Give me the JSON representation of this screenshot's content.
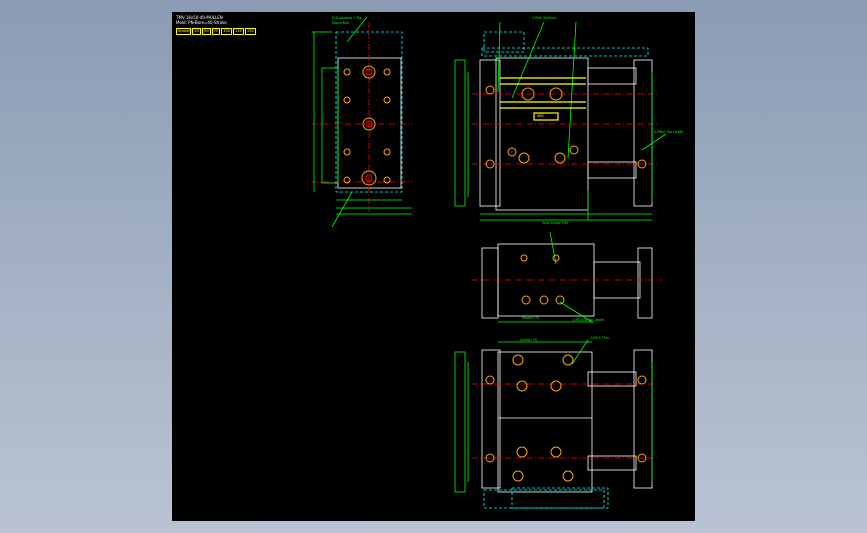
{
  "title_block": {
    "line1": "TMV-16x50-40-MULLEN",
    "line2": "Mold: PN-Bore=40-Stroke"
  },
  "strokes": [
    "Stroke",
    "25",
    "50",
    "75",
    "100",
    "125",
    "150"
  ],
  "labels": {
    "cap_tap": "M-6 Adapted 1 Tap",
    "depth_note": "Depth 8x8",
    "ports": "2-Port (Outline)",
    "side_tap": "4-M6x1 Tap Depth",
    "bottom_tap": "4-M5x0.8 Tap Depth",
    "thru": "2-Ø5.5 Thru",
    "dim_stroke": "Stroke+70",
    "dim_total": "Total Stroke +82",
    "bar_tag": "SMC"
  },
  "colors": {
    "bg": "#000000",
    "outline": "#ffffff",
    "dims": "#00ff00",
    "hidden": "#00ffff",
    "center": "#ff0000",
    "holes": "#ffa500",
    "highlight": "#ffff00"
  }
}
